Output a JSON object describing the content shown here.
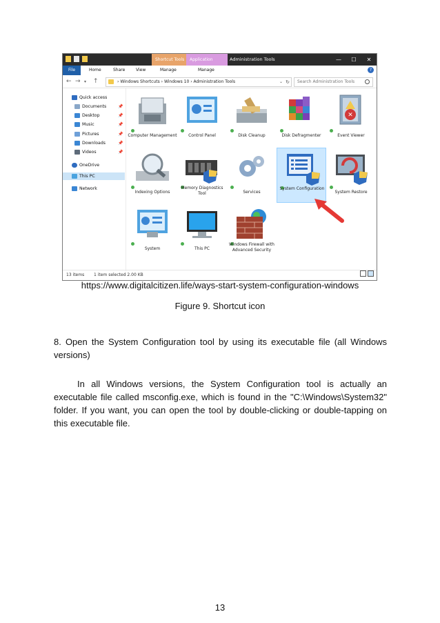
{
  "window": {
    "context_tabs": [
      "Shortcut Tools",
      "Application Tools"
    ],
    "title": "Administration Tools",
    "window_buttons": [
      "—",
      "☐",
      "✕"
    ],
    "ribbon_tabs": [
      "File",
      "Home",
      "Share",
      "View",
      "Manage",
      "Manage"
    ],
    "help": "?",
    "address": {
      "crumbs": [
        "Windows Shortcuts",
        "Windows 10",
        "Administration Tools"
      ],
      "search_placeholder": "Search Administration Tools"
    },
    "nav": [
      {
        "label": "Quick access",
        "icon": "star-icon",
        "color": "#2f6cc0",
        "pinned": false
      },
      {
        "label": "Documents",
        "icon": "documents-icon",
        "color": "#8aa7c8",
        "pinned": true
      },
      {
        "label": "Desktop",
        "icon": "desktop-icon",
        "color": "#3a86d4",
        "pinned": true
      },
      {
        "label": "Music",
        "icon": "music-icon",
        "color": "#3a86d4",
        "pinned": true
      },
      {
        "label": "Pictures",
        "icon": "pictures-icon",
        "color": "#6fa0d8",
        "pinned": true
      },
      {
        "label": "Downloads",
        "icon": "downloads-icon",
        "color": "#3a86d4",
        "pinned": true
      },
      {
        "label": "Videos",
        "icon": "videos-icon",
        "color": "#5e6b7a",
        "pinned": true
      },
      {
        "label": "OneDrive",
        "icon": "onedrive-icon",
        "color": "#2f6cc0",
        "pinned": false
      },
      {
        "label": "This PC",
        "icon": "thispc-icon",
        "color": "#4aa3df",
        "pinned": false
      },
      {
        "label": "Network",
        "icon": "network-icon",
        "color": "#3a86d4",
        "pinned": false
      }
    ],
    "tiles": [
      {
        "label": "Computer Management",
        "icon": "computer-management-icon"
      },
      {
        "label": "Control Panel",
        "icon": "control-panel-icon"
      },
      {
        "label": "Disk Cleanup",
        "icon": "disk-cleanup-icon"
      },
      {
        "label": "Disk Defragmenter",
        "icon": "disk-defragmenter-icon"
      },
      {
        "label": "Event Viewer",
        "icon": "event-viewer-icon"
      },
      {
        "label": "Indexing Options",
        "icon": "indexing-options-icon"
      },
      {
        "label": "Memory Diagnostics Tool",
        "icon": "memory-diagnostics-icon"
      },
      {
        "label": "Services",
        "icon": "services-icon"
      },
      {
        "label": "System Configuration",
        "icon": "system-configuration-icon",
        "selected": true
      },
      {
        "label": "System Restore",
        "icon": "system-restore-icon"
      },
      {
        "label": "System",
        "icon": "system-icon"
      },
      {
        "label": "This PC",
        "icon": "this-pc-icon"
      },
      {
        "label": "Windows Firewall with Advanced Security",
        "icon": "firewall-icon"
      }
    ],
    "status": {
      "count": "13 items",
      "selection": "1 item selected  2.00 KB"
    }
  },
  "url": "https://www.digitalcitizen.life/ways-start-system-configuration-windows",
  "caption": "Figure 9. Shortcut icon",
  "heading": "8. Open the System Configuration tool by using its executable file (all Windows versions)",
  "paragraph": "In all Windows versions, the System Configuration tool is actually an executable file called msconfig.exe, which is found in the \"C:\\Windows\\System32\" folder. If you want, you can open the tool by double-clicking or double-tapping on this executable file.",
  "page_number": "13"
}
